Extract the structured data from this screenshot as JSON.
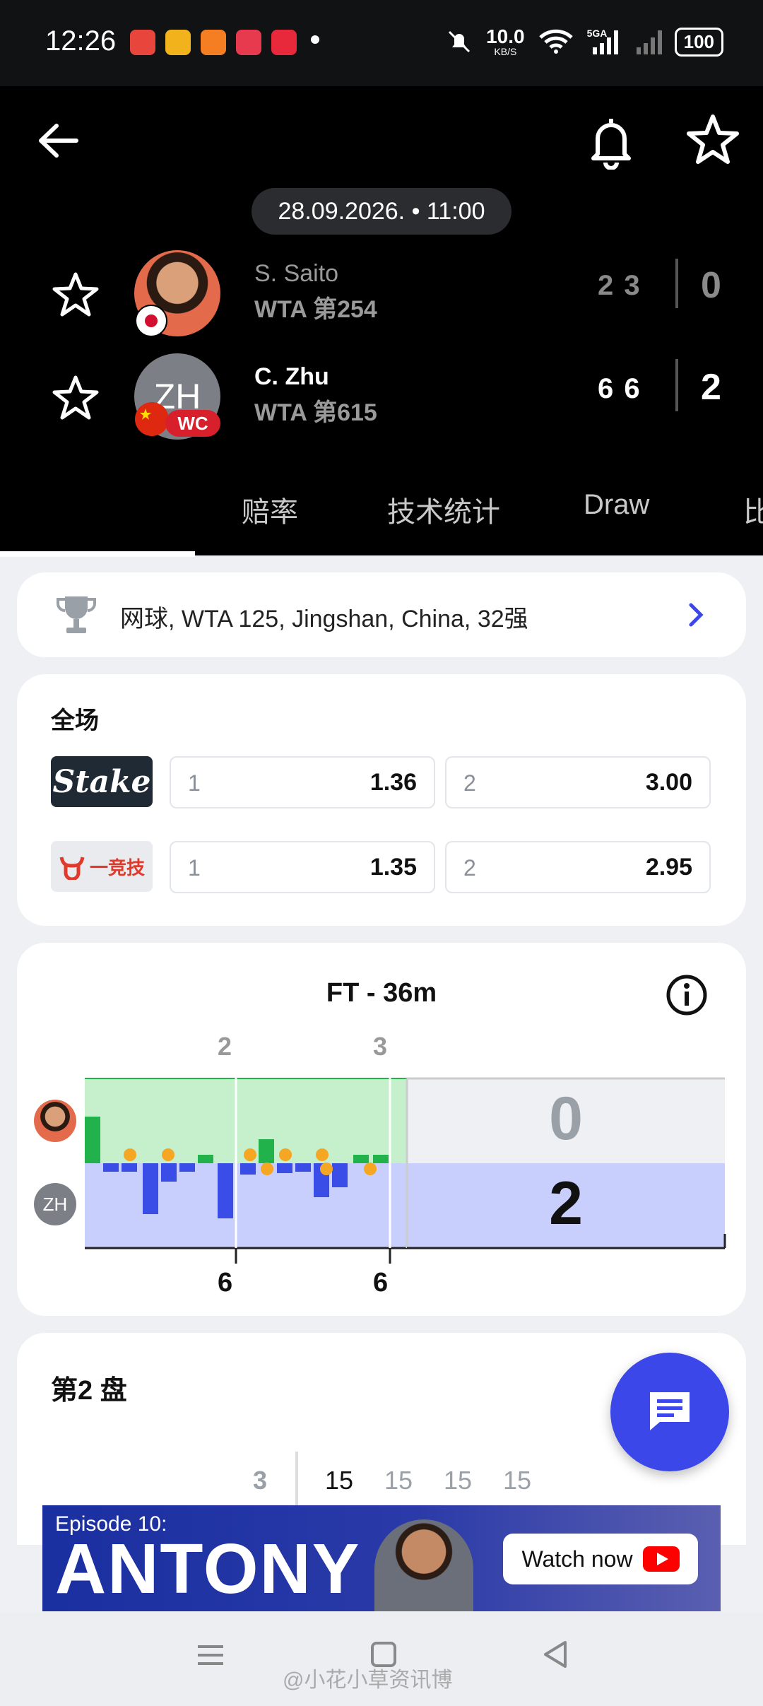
{
  "status_bar": {
    "time": "12:26",
    "net_speed_value": "10.0",
    "net_speed_unit": "KB/S",
    "signal_label": "5GA",
    "battery": "100"
  },
  "header": {
    "date_time": "28.09.2026. • 11:00",
    "players": [
      {
        "name": "S. Saito",
        "rank": "WTA 第254",
        "sets": "2 3",
        "total": "0",
        "flag": "Japan"
      },
      {
        "name": "C. Zhu",
        "rank": "WTA 第615",
        "sets": "6 6",
        "total": "2",
        "flag": "China",
        "initials": "ZH",
        "badge": "WC"
      }
    ]
  },
  "tabs": [
    {
      "label": "赔率"
    },
    {
      "label": "技术统计"
    },
    {
      "label": "Draw"
    },
    {
      "label": "比"
    }
  ],
  "breadcrumb": {
    "text": "网球, WTA 125, Jingshan, China, 32强"
  },
  "odds": {
    "title": "全场",
    "bookmakers": [
      {
        "name": "Stake",
        "o1_label": "1",
        "o1": "1.36",
        "o2_label": "2",
        "o2": "3.00"
      },
      {
        "name": "一竞技",
        "o1_label": "1",
        "o1": "1.35",
        "o2_label": "2",
        "o2": "2.95"
      }
    ]
  },
  "momentum": {
    "title": "FT - 36m",
    "set_top_labels": [
      "2",
      "3"
    ],
    "set_bottom_labels": [
      "6",
      "6"
    ],
    "avatar_initials": "ZH",
    "score_top": "0",
    "score_bottom": "2"
  },
  "set_section": {
    "title": "第2 盘",
    "left_num": "3",
    "points": [
      "15",
      "15",
      "15",
      "15"
    ]
  },
  "ad": {
    "episode": "Episode 10:",
    "headline": "ANTONY",
    "cta": "Watch now"
  },
  "watermark": "@小花小草资讯博",
  "colors": {
    "accent": "#3b47e8",
    "top_player_zone": "#c6efcc",
    "bottom_player_zone": "#c9cffc",
    "top_bar": "#22b24c",
    "bottom_bar": "#3a4de6",
    "serve_dot": "#f5a623"
  }
}
